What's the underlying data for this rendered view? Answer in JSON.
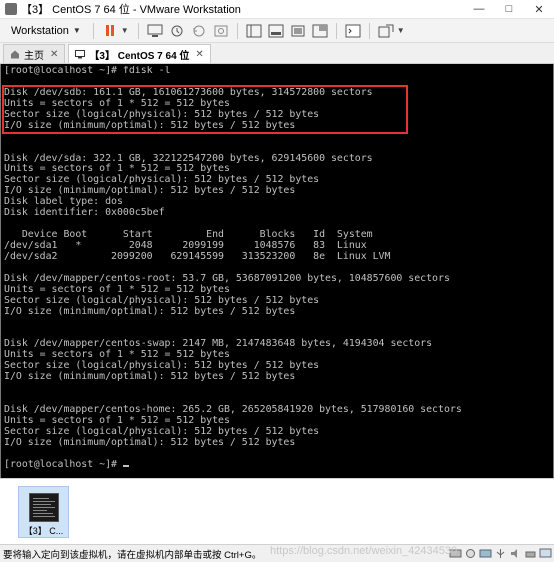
{
  "window": {
    "title": "【3】 CentOS 7 64 位 - VMware Workstation"
  },
  "toolbar": {
    "workstation_menu_label": "Workstation"
  },
  "tabs": [
    {
      "label": "主页",
      "closable": true
    },
    {
      "label": "【3】 CentOS 7 64 位",
      "closable": true
    }
  ],
  "terminal": {
    "lines": [
      "[root@localhost ~]# fdisk -l",
      "",
      "Disk /dev/sdb: 161.1 GB, 161061273600 bytes, 314572800 sectors",
      "Units = sectors of 1 * 512 = 512 bytes",
      "Sector size (logical/physical): 512 bytes / 512 bytes",
      "I/O size (minimum/optimal): 512 bytes / 512 bytes",
      "",
      "",
      "Disk /dev/sda: 322.1 GB, 322122547200 bytes, 629145600 sectors",
      "Units = sectors of 1 * 512 = 512 bytes",
      "Sector size (logical/physical): 512 bytes / 512 bytes",
      "I/O size (minimum/optimal): 512 bytes / 512 bytes",
      "Disk label type: dos",
      "Disk identifier: 0x000c5bef",
      "",
      "   Device Boot      Start         End      Blocks   Id  System",
      "/dev/sda1   *        2048     2099199     1048576   83  Linux",
      "/dev/sda2         2099200   629145599   313523200   8e  Linux LVM",
      "",
      "Disk /dev/mapper/centos-root: 53.7 GB, 53687091200 bytes, 104857600 sectors",
      "Units = sectors of 1 * 512 = 512 bytes",
      "Sector size (logical/physical): 512 bytes / 512 bytes",
      "I/O size (minimum/optimal): 512 bytes / 512 bytes",
      "",
      "",
      "Disk /dev/mapper/centos-swap: 2147 MB, 2147483648 bytes, 4194304 sectors",
      "Units = sectors of 1 * 512 = 512 bytes",
      "Sector size (logical/physical): 512 bytes / 512 bytes",
      "I/O size (minimum/optimal): 512 bytes / 512 bytes",
      "",
      "",
      "Disk /dev/mapper/centos-home: 265.2 GB, 265205841920 bytes, 517980160 sectors",
      "Units = sectors of 1 * 512 = 512 bytes",
      "Sector size (logical/physical): 512 bytes / 512 bytes",
      "I/O size (minimum/optimal): 512 bytes / 512 bytes",
      "",
      "[root@localhost ~]# "
    ]
  },
  "thumbnail": {
    "label": "【3】 C..."
  },
  "statusbar": {
    "text": "要将输入定向到该虚拟机，请在虚拟机内部单击或按 Ctrl+G。",
    "watermark": "https://blog.csdn.net/weixin_42434530"
  },
  "colors": {
    "highlight_box": "#e33333",
    "terminal_bg": "#000000",
    "terminal_fg": "#c0c0c0",
    "pause_icon": "#e8542a"
  }
}
